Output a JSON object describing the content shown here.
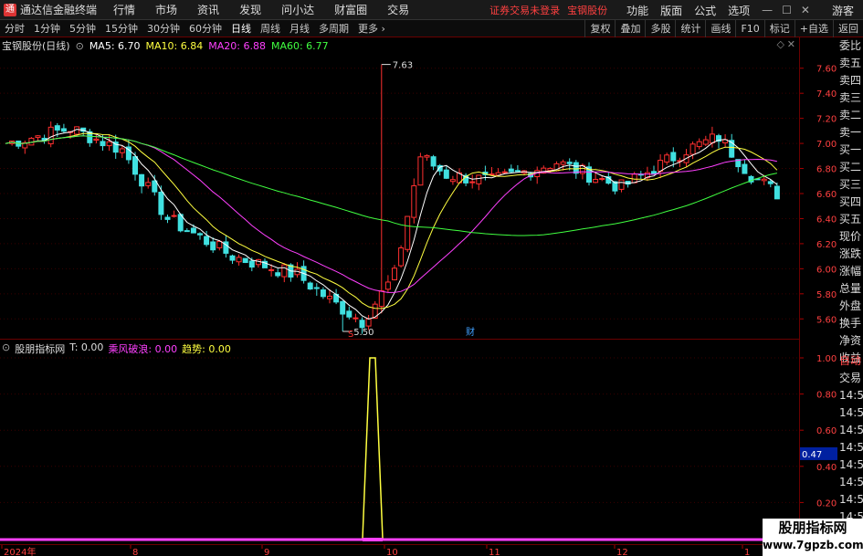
{
  "app": {
    "title": "通达信金融终端"
  },
  "menu": [
    "行情",
    "市场",
    "资讯",
    "发现",
    "问小达",
    "财富圈",
    "交易"
  ],
  "notices": {
    "login": "证券交易未登录",
    "stock": "宝钢股份"
  },
  "right_menu": [
    "功能",
    "版面",
    "公式",
    "选项"
  ],
  "guest": "游客",
  "periods": [
    "分时",
    "1分钟",
    "5分钟",
    "15分钟",
    "30分钟",
    "60分钟",
    "日线",
    "周线",
    "月线",
    "多周期",
    "更多"
  ],
  "active_period": "日线",
  "tools": [
    "复权",
    "叠加",
    "多股",
    "统计",
    "画线",
    "F10",
    "标记",
    "+自选",
    "返回"
  ],
  "main": {
    "stock_label": "宝钢股份(日线)",
    "ma": [
      {
        "label": "MA5: 6.70",
        "color": "#ffffff"
      },
      {
        "label": "MA10: 6.84",
        "color": "#ffff40"
      },
      {
        "label": "MA20: 6.88",
        "color": "#ff40ff"
      },
      {
        "label": "MA60: 6.77",
        "color": "#40ff40"
      }
    ],
    "high_label": "7.63",
    "low_label": "5.50",
    "marker_s": "S",
    "marker_cai": "财"
  },
  "indicator": {
    "name": "股朋指标网",
    "t_value": "T: 0.00",
    "wind_label": "乘风破浪: 0.00",
    "trend_label": "趋势: 0.00"
  },
  "yaxis_main": [
    "7.60",
    "7.40",
    "7.20",
    "7.00",
    "6.80",
    "6.60",
    "6.40",
    "6.20",
    "6.00",
    "5.80",
    "5.60"
  ],
  "yaxis_ind": [
    "1.00",
    "0.80",
    "0.60",
    "0.40",
    "0.20"
  ],
  "ind_marker": "0.47",
  "xaxis": [
    "2024年",
    "8",
    "9",
    "10",
    "11",
    "12",
    "1"
  ],
  "side_top": [
    "委比",
    "卖五",
    "卖四",
    "卖三",
    "卖二",
    "卖一",
    "买一",
    "买二",
    "买三",
    "买四",
    "买五",
    "现价",
    "涨跌",
    "涨幅",
    "总量",
    "外盘",
    "换手",
    "净资",
    "收益"
  ],
  "side_bottom": [
    "自动",
    "交易",
    "14:56",
    "14:56",
    "14:56",
    "14:56",
    "14:56",
    "14:56",
    "14:56",
    "14:56",
    "14:56"
  ],
  "watermark": {
    "title": "股朋指标网",
    "url": "www.7gpzb.com"
  },
  "colors": {
    "up": "#ff3030",
    "down": "#40e0e0",
    "grid": "#6a0000"
  },
  "chart_data": {
    "type": "line",
    "x": [
      "2024年",
      "8",
      "9",
      "10",
      "11",
      "12",
      "1"
    ],
    "ylim": [
      5.5,
      7.63
    ],
    "series": [
      {
        "name": "MA5",
        "values": [
          6.9,
          7.0,
          6.6,
          6.1,
          5.8,
          5.6,
          6.5,
          6.8,
          6.7,
          6.8,
          6.9,
          7.0,
          6.9,
          6.7
        ]
      },
      {
        "name": "MA10",
        "values": [
          6.85,
          6.95,
          6.7,
          6.2,
          5.9,
          5.65,
          6.3,
          6.75,
          6.7,
          6.75,
          6.85,
          6.95,
          6.95,
          6.84
        ]
      },
      {
        "name": "MA20",
        "values": [
          6.8,
          6.9,
          6.8,
          6.4,
          6.0,
          5.7,
          6.0,
          6.6,
          6.7,
          6.72,
          6.8,
          6.9,
          7.0,
          6.88
        ]
      },
      {
        "name": "MA60",
        "values": [
          6.95,
          6.95,
          6.9,
          6.75,
          6.55,
          6.4,
          6.3,
          6.25,
          6.25,
          6.3,
          6.45,
          6.6,
          6.78,
          6.77
        ]
      }
    ]
  }
}
